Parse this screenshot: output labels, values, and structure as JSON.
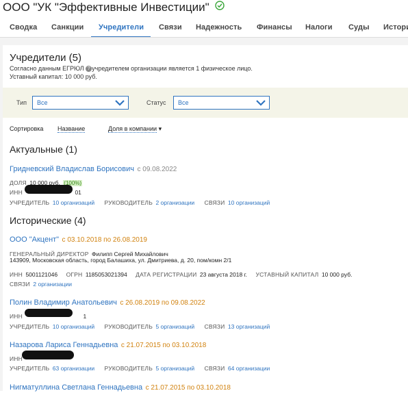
{
  "company": {
    "title": "ООО \"УК \"Эффективные Инвестиции\""
  },
  "tabs": [
    {
      "label": "Сводка"
    },
    {
      "label": "Санкции"
    },
    {
      "label": "Учредители"
    },
    {
      "label": "Связи"
    },
    {
      "label": "Надежность"
    },
    {
      "label": "Финансы"
    },
    {
      "label": "Налоги"
    },
    {
      "label": "Суды"
    },
    {
      "label": "Истори"
    }
  ],
  "active_tab": "Учредители",
  "section": {
    "title": "Учредители (5)",
    "note_prefix": "Согласно данным ЕГРЮЛ",
    "note_suffix": "учредителем организации является 1 физическое лицо.",
    "capital": "Уставный капитал: 10 000 руб."
  },
  "filters": {
    "type_label": "Тип",
    "type_value": "Все",
    "status_label": "Статус",
    "status_value": "Все"
  },
  "sort": {
    "label": "Сортировка",
    "by_name": "Название",
    "by_share": "Доля в компании",
    "arrow": "▾"
  },
  "current": {
    "heading": "Актуальные (1)",
    "person": {
      "name": "Гридневский Владислав Борисович",
      "since": "с 09.08.2022",
      "share_label": "ДОЛЯ",
      "share_value": "10 000 руб.",
      "share_pct": "(100%)",
      "inn_label": "ИНН",
      "inn_partial": "01",
      "founder_label": "УЧРЕДИТЕЛЬ",
      "founder_link": "10 организаций",
      "head_label": "РУКОВОДИТЕЛЬ",
      "head_link": "2 организации",
      "links_label": "СВЯЗИ",
      "links_link": "10 организаций"
    }
  },
  "historic": {
    "heading": "Исторические (4)",
    "items": [
      {
        "name": "ООО \"Акцент\"",
        "period": "с 03.10.2018 по 26.08.2019",
        "director_label": "ГЕНЕРАЛЬНЫЙ ДИРЕКТОР",
        "director": "Филипп Сергей Михайлович",
        "address": "143909, Московская область, город Балашиха, ул. Дмитриева, д. 20, пом/комн 2/1",
        "inn_label": "ИНН",
        "inn": "5001121046",
        "ogrn_label": "ОГРН",
        "ogrn": "1185053021394",
        "reg_label": "ДАТА РЕГИСТРАЦИИ",
        "reg": "23 августа 2018 г.",
        "cap_label": "УСТАВНЫЙ КАПИТАЛ",
        "cap": "10 000 руб.",
        "links_label": "СВЯЗИ",
        "links_link": "2 организации"
      },
      {
        "name": "Полин Владимир Анатольевич",
        "period": "с 26.08.2019 по 09.08.2022",
        "inn_label": "ИНН",
        "inn_partial": "1",
        "founder_label": "УЧРЕДИТЕЛЬ",
        "founder_link": "10 организаций",
        "head_label": "РУКОВОДИТЕЛЬ",
        "head_link": "5 организаций",
        "links_label": "СВЯЗИ",
        "links_link": "13 организаций"
      },
      {
        "name": "Назарова Лариса Геннадьевна",
        "period": "с 21.07.2015 по 03.10.2018",
        "inn_label": "ИНН",
        "founder_label": "УЧРЕДИТЕЛЬ",
        "founder_link": "63 организации",
        "head_label": "РУКОВОДИТЕЛЬ",
        "head_link": "5 организаций",
        "links_label": "СВЯЗИ",
        "links_link": "64 организации"
      },
      {
        "name": "Нигматуллина Светлана Геннадьевна",
        "period": "с 21.07.2015 по 03.10.2018"
      }
    ]
  },
  "colors": {
    "accent": "#2f74c0",
    "orange": "#d1820f",
    "green": "#3a8a1a"
  }
}
